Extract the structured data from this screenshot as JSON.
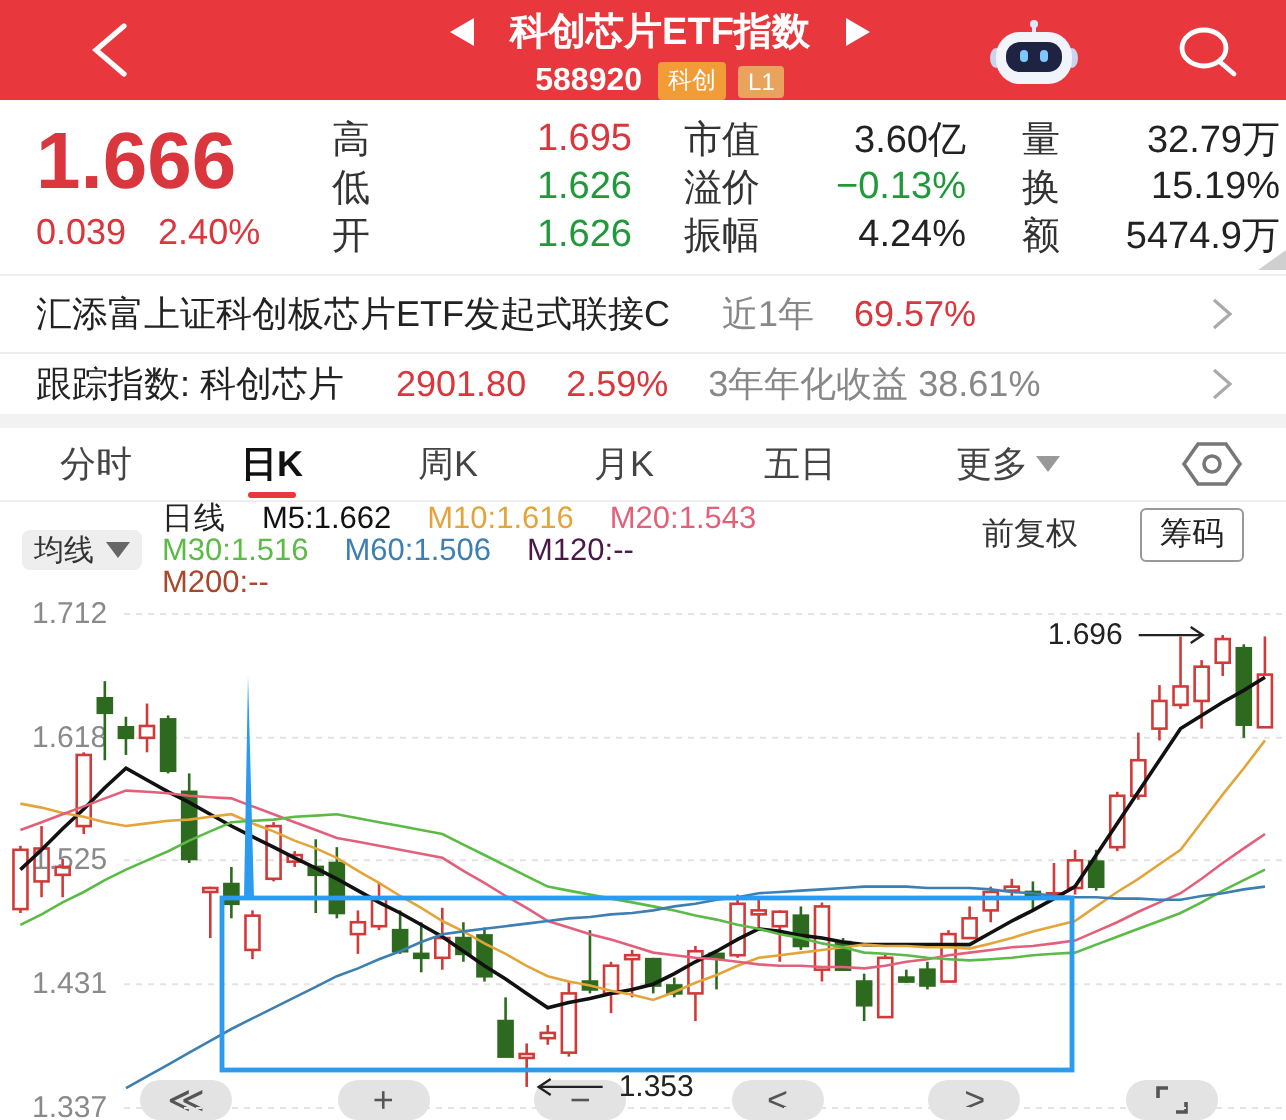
{
  "header": {
    "title": "科创芯片ETF指数",
    "code": "588920",
    "badges": [
      {
        "label": "科创",
        "color": "#f29c38"
      },
      {
        "label": "L1",
        "color": "#e9a35c"
      }
    ]
  },
  "quote": {
    "price": "1.666",
    "change": "0.039",
    "change_pct": "2.40%",
    "color": "#d9363e",
    "stats": [
      {
        "label": "高",
        "value": "1.695",
        "color": "#d9363e"
      },
      {
        "label": "市值",
        "value": "3.60亿",
        "color": "#222222"
      },
      {
        "label": "量",
        "value": "32.79万",
        "color": "#222222"
      },
      {
        "label": "低",
        "value": "1.626",
        "color": "#1f9a3a"
      },
      {
        "label": "溢价",
        "value": "−0.13%",
        "color": "#1f9a3a"
      },
      {
        "label": "换",
        "value": "15.19%",
        "color": "#222222"
      },
      {
        "label": "开",
        "value": "1.626",
        "color": "#1f9a3a"
      },
      {
        "label": "振幅",
        "value": "4.24%",
        "color": "#222222"
      },
      {
        "label": "额",
        "value": "5474.9万",
        "color": "#222222"
      }
    ]
  },
  "fund_rows": [
    {
      "name": "汇添富上证科创板芯片ETF发起式联接C",
      "metrics": [
        {
          "text": "近1年",
          "color": "#888888"
        },
        {
          "text": "69.57%",
          "color": "#d9363e"
        }
      ]
    },
    {
      "name": "跟踪指数: 科创芯片",
      "metrics": [
        {
          "text": "2901.80",
          "color": "#d9363e"
        },
        {
          "text": "2.59%",
          "color": "#d9363e"
        },
        {
          "text": "3年年化收益 38.61%",
          "color": "#888888"
        }
      ]
    }
  ],
  "tabs": [
    {
      "label": "分时",
      "selected": false
    },
    {
      "label": "日K",
      "selected": true
    },
    {
      "label": "周K",
      "selected": false
    },
    {
      "label": "月K",
      "selected": false
    },
    {
      "label": "五日",
      "selected": false
    },
    {
      "label": "更多",
      "selected": false,
      "dropdown": true
    }
  ],
  "legend": {
    "mode": "均线",
    "items": [
      {
        "text": "日线",
        "color": "#222222"
      },
      {
        "text": "M5:1.662",
        "color": "#111111"
      },
      {
        "text": "M10:1.616",
        "color": "#e3a53a"
      },
      {
        "text": "M20:1.543",
        "color": "#e2607a"
      },
      {
        "text": "M30:1.516",
        "color": "#5cba47"
      },
      {
        "text": "M60:1.506",
        "color": "#3c7fb0"
      },
      {
        "text": "M120:--",
        "color": "#4a1747"
      },
      {
        "text": "M200:--",
        "color": "#a8472a"
      }
    ],
    "adjust": "前复权",
    "chips_button": "筹码"
  },
  "chart": {
    "chart_data": {
      "type": "candlestick",
      "categories": [
        null,
        null,
        null,
        null,
        null,
        null,
        null,
        null,
        null,
        null,
        null,
        null,
        null,
        null,
        null,
        null,
        null,
        null,
        null,
        null,
        null,
        null,
        null,
        null,
        null,
        null,
        null,
        null,
        null,
        null,
        null,
        null,
        null,
        null,
        null,
        null,
        null,
        null,
        null,
        null,
        null,
        null,
        null,
        null,
        null,
        null,
        null,
        null,
        null,
        null,
        null,
        null,
        null,
        null,
        null,
        null,
        null,
        null,
        null,
        null
      ],
      "ylim": [
        1.337,
        1.712
      ],
      "yticks": [
        1.337,
        1.431,
        1.525,
        1.618,
        1.712
      ],
      "grid": true,
      "ohlc": [
        [
          1.488,
          1.536,
          1.485,
          1.533
        ],
        [
          1.509,
          1.551,
          1.497,
          1.534
        ],
        [
          1.514,
          1.526,
          1.497,
          1.52
        ],
        [
          1.551,
          1.607,
          1.545,
          1.605
        ],
        [
          1.648,
          1.661,
          1.601,
          1.637
        ],
        [
          1.626,
          1.634,
          1.605,
          1.618
        ],
        [
          1.618,
          1.644,
          1.607,
          1.627
        ],
        [
          1.632,
          1.635,
          1.591,
          1.593
        ],
        [
          1.577,
          1.591,
          1.523,
          1.526
        ],
        [
          1.501,
          1.505,
          1.466,
          1.504
        ],
        [
          1.507,
          1.52,
          1.481,
          1.492
        ],
        [
          1.457,
          1.487,
          1.45,
          1.483
        ],
        [
          1.511,
          1.554,
          1.509,
          1.551
        ],
        [
          1.524,
          1.532,
          1.52,
          1.529
        ],
        [
          1.52,
          1.541,
          1.485,
          1.514
        ],
        [
          1.523,
          1.535,
          1.481,
          1.485
        ],
        [
          1.469,
          1.487,
          1.454,
          1.478
        ],
        [
          1.475,
          1.508,
          1.472,
          1.496
        ],
        [
          1.472,
          1.487,
          1.454,
          1.456
        ],
        [
          1.454,
          1.478,
          1.44,
          1.451
        ],
        [
          1.451,
          1.489,
          1.442,
          1.466
        ],
        [
          1.466,
          1.478,
          1.448,
          1.454
        ],
        [
          1.468,
          1.474,
          1.433,
          1.437
        ],
        [
          1.403,
          1.421,
          1.376,
          1.376
        ],
        [
          1.375,
          1.386,
          1.353,
          1.378
        ],
        [
          1.39,
          1.4,
          1.385,
          1.394
        ],
        [
          1.379,
          1.433,
          1.376,
          1.424
        ],
        [
          1.433,
          1.472,
          1.424,
          1.427
        ],
        [
          1.424,
          1.448,
          1.409,
          1.445
        ],
        [
          1.45,
          1.457,
          1.421,
          1.453
        ],
        [
          1.45,
          1.451,
          1.424,
          1.43
        ],
        [
          1.43,
          1.436,
          1.421,
          1.424
        ],
        [
          1.424,
          1.46,
          1.403,
          1.456
        ],
        [
          1.454,
          1.457,
          1.427,
          1.451
        ],
        [
          1.453,
          1.499,
          1.451,
          1.492
        ],
        [
          1.484,
          1.496,
          1.472,
          1.487
        ],
        [
          1.475,
          1.487,
          1.448,
          1.486
        ],
        [
          1.483,
          1.49,
          1.457,
          1.46
        ],
        [
          1.442,
          1.493,
          1.433,
          1.49
        ],
        [
          1.463,
          1.466,
          1.442,
          1.442
        ],
        [
          1.433,
          1.439,
          1.403,
          1.415
        ],
        [
          1.406,
          1.454,
          1.406,
          1.451
        ],
        [
          1.436,
          1.442,
          1.432,
          1.433
        ],
        [
          1.442,
          1.448,
          1.427,
          1.43
        ],
        [
          1.433,
          1.472,
          1.433,
          1.469
        ],
        [
          1.466,
          1.49,
          1.466,
          1.481
        ],
        [
          1.487,
          1.505,
          1.478,
          1.501
        ],
        [
          1.502,
          1.511,
          1.497,
          1.505
        ],
        [
          1.501,
          1.509,
          1.487,
          1.497
        ],
        [
          1.498,
          1.523,
          1.497,
          1.5
        ],
        [
          1.504,
          1.533,
          1.499,
          1.525
        ],
        [
          1.524,
          1.533,
          1.502,
          1.505
        ],
        [
          1.535,
          1.577,
          1.532,
          1.574
        ],
        [
          1.574,
          1.622,
          1.571,
          1.601
        ],
        [
          1.625,
          1.658,
          1.616,
          1.646
        ],
        [
          1.643,
          1.695,
          1.64,
          1.657
        ],
        [
          1.646,
          1.677,
          1.625,
          1.672
        ],
        [
          1.675,
          1.696,
          1.665,
          1.693
        ],
        [
          1.686,
          1.689,
          1.618,
          1.628
        ],
        [
          1.626,
          1.695,
          1.626,
          1.666
        ]
      ],
      "series": [
        {
          "type": "line",
          "color": "#111111",
          "values": [
            1.518,
            1.533,
            1.549,
            1.564,
            1.58,
            1.595,
            1.586,
            1.577,
            1.569,
            1.56,
            1.551,
            1.543,
            1.535,
            1.527,
            1.519,
            1.511,
            1.502,
            1.493,
            1.485,
            1.476,
            1.467,
            1.456,
            1.445,
            1.435,
            1.424,
            1.413,
            1.417,
            1.42,
            1.424,
            1.427,
            1.431,
            1.439,
            1.448,
            1.456,
            1.465,
            1.473,
            1.471,
            1.468,
            1.466,
            1.463,
            1.461,
            1.461,
            1.461,
            1.461,
            1.461,
            1.461,
            1.47,
            1.479,
            1.487,
            1.496,
            1.505,
            1.529,
            1.553,
            1.577,
            1.601,
            1.625,
            1.635,
            1.645,
            1.654,
            1.664
          ]
        },
        {
          "type": "line",
          "color": "#e3a53a",
          "values": [
            1.568,
            1.565,
            1.561,
            1.558,
            1.554,
            1.551,
            1.553,
            1.555,
            1.556,
            1.558,
            1.56,
            1.553,
            1.547,
            1.54,
            1.534,
            1.527,
            1.517,
            1.508,
            1.498,
            1.489,
            1.479,
            1.471,
            1.462,
            1.454,
            1.445,
            1.437,
            1.433,
            1.43,
            1.426,
            1.423,
            1.419,
            1.425,
            1.432,
            1.438,
            1.445,
            1.451,
            1.453,
            1.455,
            1.457,
            1.459,
            1.461,
            1.46,
            1.46,
            1.459,
            1.459,
            1.458,
            1.462,
            1.466,
            1.471,
            1.475,
            1.479,
            1.49,
            1.501,
            1.511,
            1.522,
            1.533,
            1.554,
            1.575,
            1.595,
            1.616
          ]
        },
        {
          "type": "line",
          "color": "#e2607a",
          "values": [
            1.548,
            1.554,
            1.56,
            1.566,
            1.572,
            1.578,
            1.577,
            1.576,
            1.574,
            1.573,
            1.572,
            1.566,
            1.56,
            1.554,
            1.548,
            1.542,
            1.539,
            1.536,
            1.533,
            1.53,
            1.527,
            1.517,
            1.508,
            1.498,
            1.489,
            1.479,
            1.474,
            1.469,
            1.465,
            1.46,
            1.455,
            1.453,
            1.451,
            1.45,
            1.448,
            1.446,
            1.445,
            1.445,
            1.444,
            1.444,
            1.443,
            1.445,
            1.448,
            1.45,
            1.453,
            1.455,
            1.457,
            1.459,
            1.46,
            1.462,
            1.464,
            1.471,
            1.478,
            1.486,
            1.493,
            1.5,
            1.511,
            1.523,
            1.534,
            1.545
          ]
        },
        {
          "type": "line",
          "color": "#5cba47",
          "values": [
            1.476,
            1.484,
            1.493,
            1.501,
            1.51,
            1.518,
            1.525,
            1.532,
            1.54,
            1.547,
            1.554,
            1.555,
            1.556,
            1.558,
            1.559,
            1.56,
            1.557,
            1.554,
            1.551,
            1.548,
            1.545,
            1.537,
            1.529,
            1.521,
            1.513,
            1.505,
            1.502,
            1.499,
            1.496,
            1.493,
            1.49,
            1.487,
            1.483,
            1.48,
            1.476,
            1.473,
            1.469,
            1.466,
            1.462,
            1.459,
            1.455,
            1.454,
            1.453,
            1.451,
            1.45,
            1.449,
            1.45,
            1.451,
            1.453,
            1.454,
            1.455,
            1.461,
            1.467,
            1.473,
            1.479,
            1.485,
            1.493,
            1.502,
            1.51,
            1.518
          ]
        },
        {
          "type": "line",
          "color": "#3c7fb0",
          "values": [
            null,
            null,
            null,
            null,
            null,
            1.352,
            1.361,
            1.37,
            1.379,
            1.388,
            1.397,
            1.405,
            1.413,
            1.421,
            1.429,
            1.437,
            1.443,
            1.45,
            1.456,
            1.463,
            1.469,
            1.471,
            1.473,
            1.475,
            1.477,
            1.479,
            1.481,
            1.482,
            1.484,
            1.485,
            1.487,
            1.49,
            1.492,
            1.495,
            1.497,
            1.5,
            1.501,
            1.502,
            1.503,
            1.504,
            1.505,
            1.505,
            1.505,
            1.504,
            1.504,
            1.504,
            1.503,
            1.501,
            1.5,
            1.498,
            1.497,
            1.497,
            1.496,
            1.496,
            1.495,
            1.495,
            1.498,
            1.5,
            1.503,
            1.505
          ]
        }
      ],
      "annotations": [
        "1.696",
        "1.353"
      ]
    },
    "drawings": [
      {
        "kind": "rectangle"
      },
      {
        "kind": "spike"
      }
    ],
    "controls": [
      {
        "kind": "first",
        "label": "≪"
      },
      {
        "kind": "zoom_in",
        "label": "+"
      },
      {
        "kind": "zoom_out",
        "label": "−"
      },
      {
        "kind": "prev",
        "label": "<"
      },
      {
        "kind": "next",
        "label": ">"
      },
      {
        "kind": "fullscreen"
      }
    ]
  }
}
